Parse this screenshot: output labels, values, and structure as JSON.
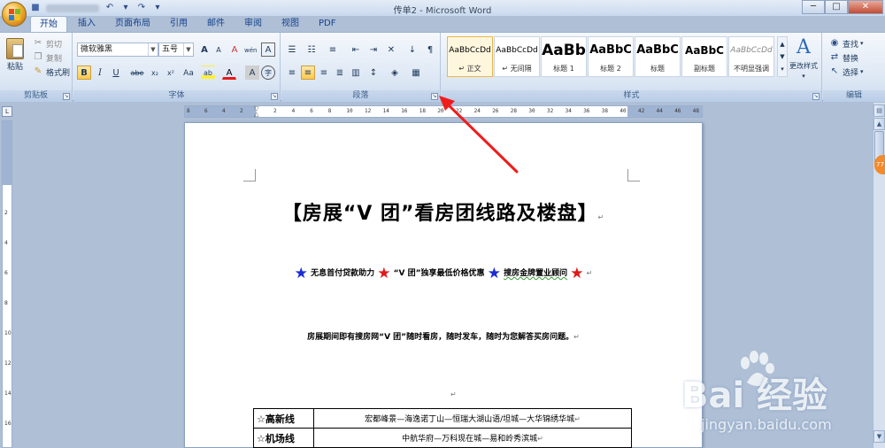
{
  "window": {
    "title": "传单2 - Microsoft Word",
    "min": "─",
    "max": "□",
    "close": "✕"
  },
  "qat": {
    "save": "■",
    "undo": "↶",
    "undo_dd": "▾",
    "redo": "↷",
    "custom": "▾"
  },
  "tabs": [
    {
      "label": "开始",
      "active": true
    },
    {
      "label": "插入"
    },
    {
      "label": "页面布局"
    },
    {
      "label": "引用"
    },
    {
      "label": "邮件"
    },
    {
      "label": "审阅"
    },
    {
      "label": "视图"
    },
    {
      "label": "PDF"
    }
  ],
  "clipboard": {
    "label": "剪贴板",
    "paste": "粘贴",
    "cut": "剪切",
    "copy": "复制",
    "format_painter": "格式刷"
  },
  "font": {
    "label": "字体",
    "name": "微软雅黑",
    "size": "五号",
    "grow": "A",
    "shrink": "A",
    "clear": "A",
    "phonetic": "wén",
    "border": "A",
    "bold": "B",
    "italic": "I",
    "underline": "U",
    "strike": "abe",
    "sub": "x₂",
    "sup": "x²",
    "case": "Aa",
    "highlight": "ab",
    "color": "A",
    "shading": "A",
    "enclose": "字"
  },
  "paragraph": {
    "label": "段落"
  },
  "styles": {
    "label": "样式",
    "items": [
      {
        "sample": "AaBbCcDd",
        "name": "↵ 正文"
      },
      {
        "sample": "AaBbCcDd",
        "name": "↵ 无间隔"
      },
      {
        "sample": "AaBb",
        "name": "标题 1"
      },
      {
        "sample": "AaBbC",
        "name": "标题 2"
      },
      {
        "sample": "AaBbC",
        "name": "标题"
      },
      {
        "sample": "AaBbC",
        "name": "副标题"
      },
      {
        "sample": "AaBbCcDd",
        "name": "不明显强调"
      }
    ],
    "change": "更改样式"
  },
  "editing": {
    "label": "编辑",
    "find": "查找",
    "replace": "替换",
    "select": "选择"
  },
  "hruler_ticks": [
    "8",
    "6",
    "4",
    "2",
    "2",
    "4",
    "6",
    "8",
    "10",
    "12",
    "14",
    "16",
    "18",
    "20",
    "22",
    "24",
    "26",
    "28",
    "30",
    "32",
    "34",
    "36",
    "38",
    "40",
    "42",
    "44",
    "46",
    "48"
  ],
  "vruler_ticks": [
    "2",
    "4",
    "6",
    "8",
    "10",
    "12",
    "14",
    "16"
  ],
  "ruler_corner": "L",
  "side_badge": "77",
  "document": {
    "title": "【房展“V 团”看房团线路及楼盘】",
    "para_mark": "↵",
    "tagline_1": "无息首付贷款助力",
    "tagline_2": "“V 团”独享最低价格优惠",
    "tagline_3": "搜房金牌置业顾问",
    "body": "房展期间即有搜房网“V 团”随时看房，随时发车，随时为您解答买房问题。",
    "star_colors": [
      "#1a2bd6",
      "#e01818",
      "#1a2bd6",
      "#e01818"
    ],
    "table": [
      {
        "label": "☆高新线",
        "value": "宏都峰景—海逸诺丁山—恒瑞大湖山语/坦城—大华锦绣华城"
      },
      {
        "label": "☆机场线",
        "value": "中航华府—万科现在城—易和岭秀滨城"
      }
    ]
  },
  "watermark": {
    "brand": "Bai  经验",
    "url": "jingyan.baidu.com"
  }
}
